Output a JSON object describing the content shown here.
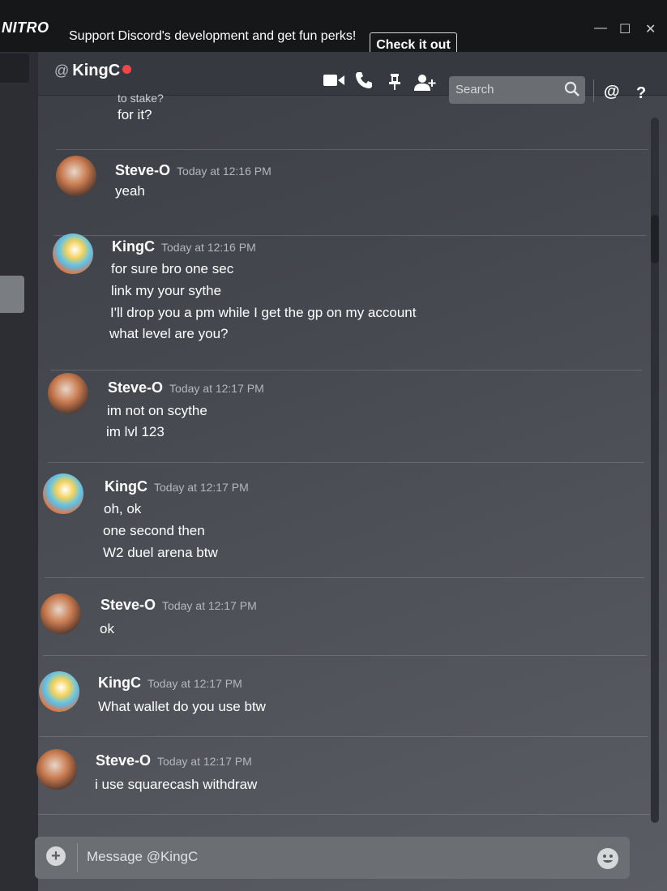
{
  "banner": {
    "logo": "NITRO",
    "text": "Support Discord's development and get fun perks!",
    "cta_label": "Check it out",
    "minimize": "—",
    "maximize": "☐",
    "close": "✕",
    "dismiss": "✖"
  },
  "header": {
    "at_symbol": "@",
    "dm_name": "KingC",
    "status_color": "#f04747",
    "icons": [
      "video-call-icon",
      "phone-call-icon",
      "pin-icon",
      "add-friend-icon",
      "search-icon",
      "mention-icon",
      "help-icon"
    ],
    "search_placeholder": "Search",
    "mention_label": "@",
    "help_label": "?"
  },
  "messages": {
    "top_fragment": [
      "to stake?",
      "for it?"
    ],
    "groups": [
      {
        "author": "Steve-O",
        "timestamp": "Today at 12:16 PM",
        "lines": [
          "yeah"
        ]
      },
      {
        "author": "KingC",
        "timestamp": "Today at 12:16 PM",
        "lines": [
          "for sure bro one sec",
          "link my your sythe",
          "I'll drop you a pm while I get the gp on my account",
          "what level are you?"
        ]
      },
      {
        "author": "Steve-O",
        "timestamp": "Today at 12:17 PM",
        "lines": [
          "im not on scythe",
          "im lvl 123"
        ]
      },
      {
        "author": "KingC",
        "timestamp": "Today at 12:17 PM",
        "lines": [
          "oh, ok",
          "one second then",
          "W2 duel arena btw"
        ]
      },
      {
        "author": "Steve-O",
        "timestamp": "Today at 12:17 PM",
        "lines": [
          "ok"
        ]
      },
      {
        "author": "KingC",
        "timestamp": "Today at 12:17 PM",
        "lines": [
          "What wallet do you use btw"
        ]
      },
      {
        "author": "Steve-O",
        "timestamp": "Today at 12:17 PM",
        "lines": [
          "i use squarecash withdraw"
        ]
      }
    ]
  },
  "composer": {
    "placeholder": "Message @KingC",
    "attach_label": "+"
  }
}
